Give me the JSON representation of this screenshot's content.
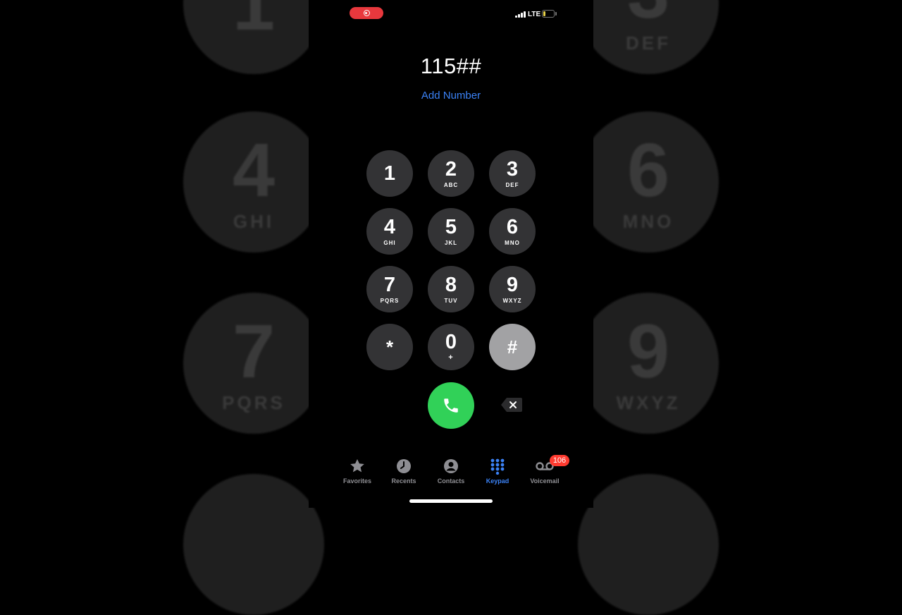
{
  "background_keys": [
    {
      "digit": "1",
      "letters": ""
    },
    {
      "digit": "3",
      "letters": "DEF"
    },
    {
      "digit": "4",
      "letters": "GHI"
    },
    {
      "digit": "6",
      "letters": "MNO"
    },
    {
      "digit": "7",
      "letters": "PQRS"
    },
    {
      "digit": "9",
      "letters": "WXYZ"
    }
  ],
  "status_bar": {
    "network": "LTE",
    "battery_level": "20",
    "battery_color": "#e9d44a",
    "recording_color": "#e8383d"
  },
  "dialer": {
    "entered_number": "115##",
    "add_number_label": "Add Number"
  },
  "keypad": {
    "keys": [
      {
        "digit": "1",
        "letters": ""
      },
      {
        "digit": "2",
        "letters": "ABC"
      },
      {
        "digit": "3",
        "letters": "DEF"
      },
      {
        "digit": "4",
        "letters": "GHI"
      },
      {
        "digit": "5",
        "letters": "JKL"
      },
      {
        "digit": "6",
        "letters": "MNO"
      },
      {
        "digit": "7",
        "letters": "PQRS"
      },
      {
        "digit": "8",
        "letters": "TUV"
      },
      {
        "digit": "9",
        "letters": "WXYZ"
      },
      {
        "digit": "*",
        "letters": ""
      },
      {
        "digit": "0",
        "letters": "+"
      },
      {
        "digit": "#",
        "letters": ""
      }
    ],
    "pressed_key": "#",
    "call_color": "#31d158"
  },
  "tab_bar": {
    "active_tab": "Keypad",
    "accent_color": "#3b82f6",
    "tabs": [
      {
        "label": "Favorites",
        "icon": "star-icon"
      },
      {
        "label": "Recents",
        "icon": "clock-icon"
      },
      {
        "label": "Contacts",
        "icon": "person-circle-icon"
      },
      {
        "label": "Keypad",
        "icon": "keypad-grid-icon"
      },
      {
        "label": "Voicemail",
        "icon": "voicemail-icon",
        "badge": "106"
      }
    ]
  }
}
